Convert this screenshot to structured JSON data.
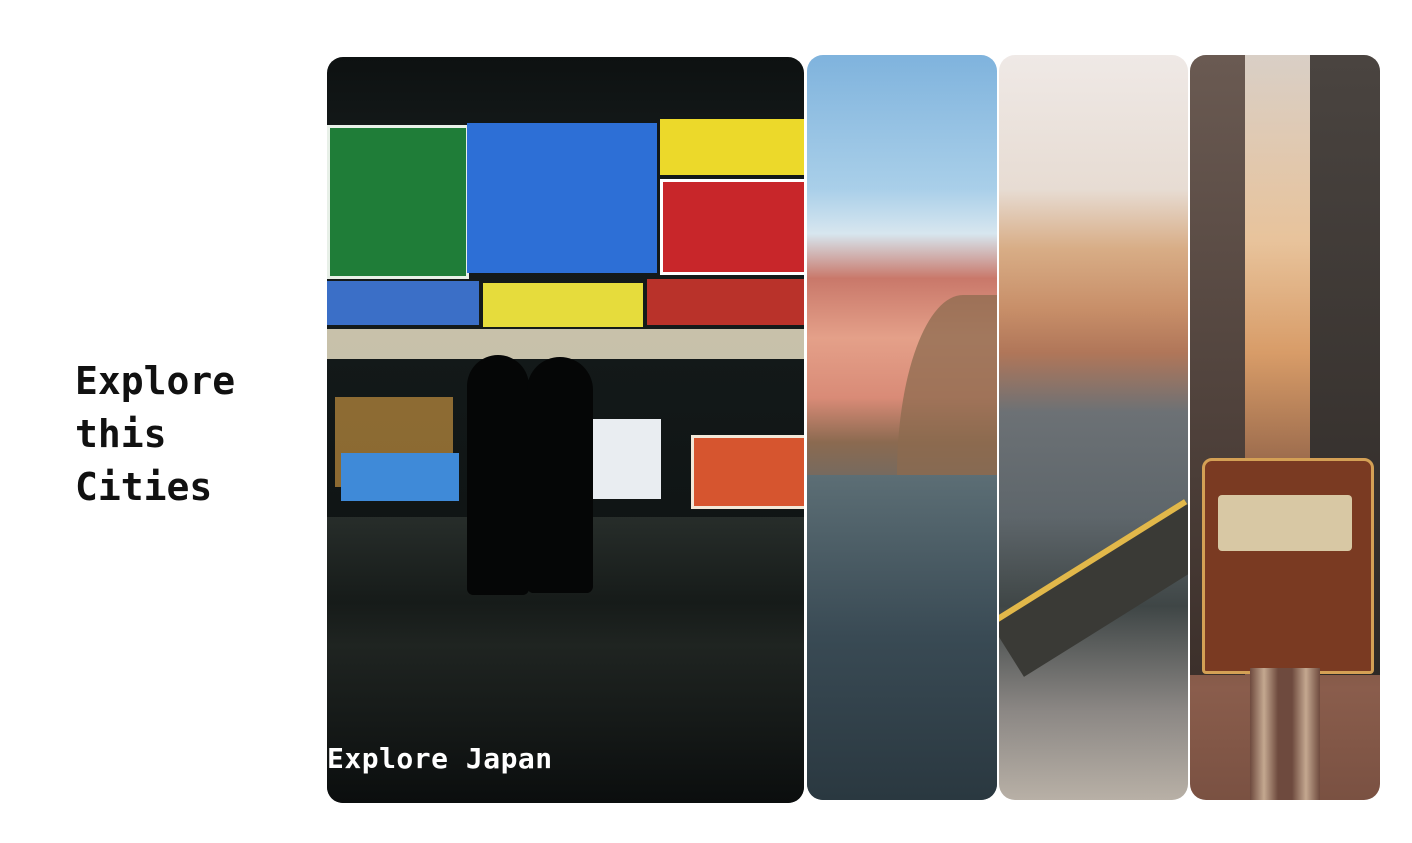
{
  "heading": {
    "lines": [
      "Explore",
      "this",
      "Cities"
    ]
  },
  "cards": [
    {
      "caption": "Explore Japan"
    }
  ],
  "colors": {
    "background": "#ffffff",
    "heading_text": "#111111",
    "caption_text": "#ffffff"
  }
}
